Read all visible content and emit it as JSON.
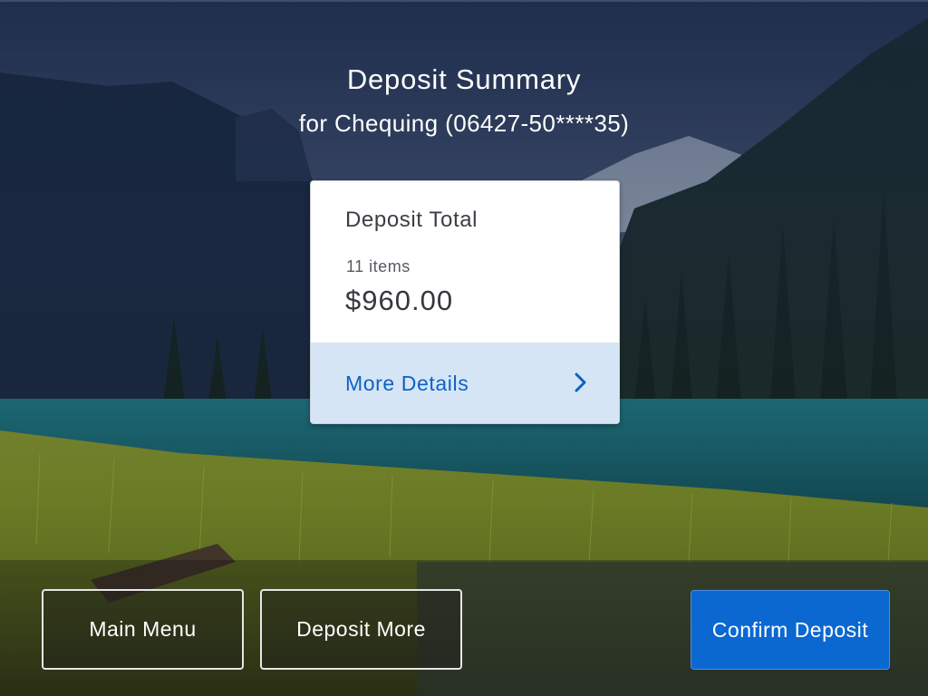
{
  "header": {
    "title": "Deposit Summary",
    "subtitle": "for Chequing (06427-50****35)"
  },
  "summary_card": {
    "title": "Deposit Total",
    "item_count": "11 items",
    "amount": "$960.00",
    "details_label": "More Details",
    "details_icon": "chevron-right-icon"
  },
  "actions": {
    "main_menu_label": "Main Menu",
    "deposit_more_label": "Deposit More",
    "confirm_label": "Confirm Deposit"
  },
  "colors": {
    "accent": "#0a68d0",
    "details_bg": "#d6e5f5",
    "details_text": "#0d62c4"
  }
}
